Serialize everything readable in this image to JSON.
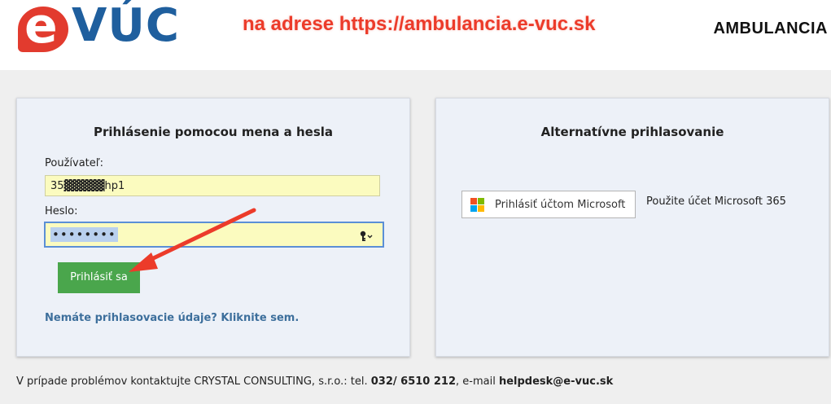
{
  "header": {
    "logo_e": "e",
    "logo_text": "VÚC",
    "headline": "na adrese https://ambulancia.e-vuc.sk",
    "section_title": "AMBULANCIA"
  },
  "login_panel": {
    "title": "Prihlásenie pomocou mena a hesla",
    "user_label": "Používateľ:",
    "user_value": "35▓▓▓▓▓hp1",
    "password_label": "Heslo:",
    "password_value": "••••••••",
    "submit_label": "Prihlásiť sa",
    "help_link": "Nemáte prihlasovacie údaje? Kliknite sem."
  },
  "alt_panel": {
    "title": "Alternatívne prihlasovanie",
    "ms_button_label": "Prihlásiť účtom Microsoft",
    "ms_hint": "Použite účet Microsoft 365"
  },
  "footer": {
    "text_prefix": "V prípade problémov kontaktujte CRYSTAL CONSULTING, s.r.o.: tel. ",
    "phone": "032/ 6510 212",
    "text_mid": ", e-mail ",
    "email": "helpdesk@e-vuc.sk"
  },
  "colors": {
    "accent_red": "#ec3b2a",
    "brand_blue": "#1f5f9e",
    "login_green": "#4aa64c",
    "input_yellow": "#fbfbbf"
  },
  "icons": [
    "key-icon",
    "microsoft-logo-icon",
    "annotation-arrow-icon"
  ]
}
